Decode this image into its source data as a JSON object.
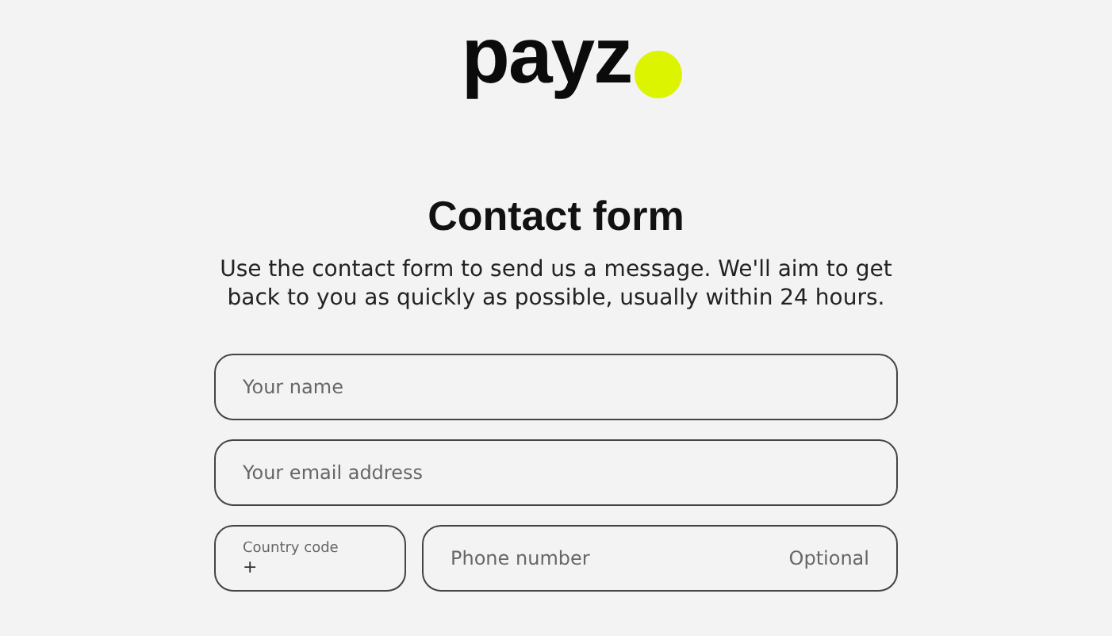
{
  "logo": {
    "text": "payz"
  },
  "title": "Contact form",
  "intro": "Use the contact form to send us a message. We'll aim to get back to you as quickly as possible, usually within 24 hours.",
  "fields": [
    {
      "placeholder": "Your name"
    },
    {
      "placeholder": "Your email address"
    }
  ],
  "phone": {
    "country_code": {
      "label": "Country code",
      "value": "+"
    },
    "number": {
      "placeholder": "Phone number",
      "hint": "Optional"
    }
  }
}
